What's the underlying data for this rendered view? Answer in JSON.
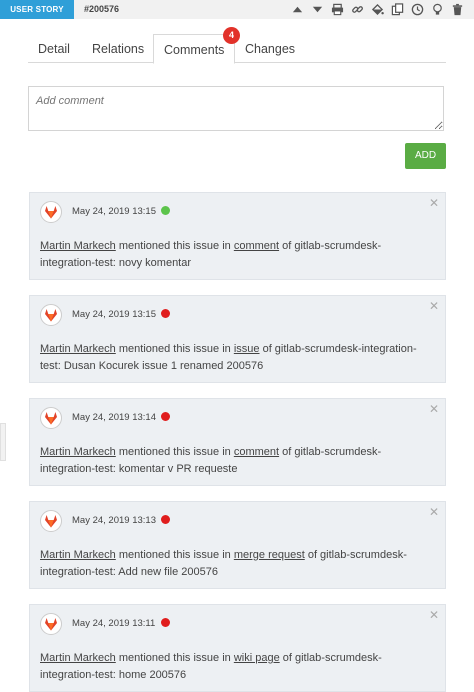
{
  "header": {
    "badge_label": "USER STORY",
    "story_id": "#200576",
    "icons": [
      "chevron-up-icon",
      "chevron-down-icon",
      "print-icon",
      "link-icon",
      "fill-icon",
      "copy-icon",
      "history-icon",
      "lightbulb-icon",
      "trash-icon"
    ]
  },
  "tabs": {
    "items": [
      {
        "label": "Detail"
      },
      {
        "label": "Relations"
      },
      {
        "label": "Comments"
      },
      {
        "label": "Changes"
      }
    ],
    "active": "Comments",
    "comments_count": "4"
  },
  "comment_form": {
    "placeholder": "Add comment",
    "add_label": "ADD"
  },
  "colors": {
    "accent": "#2f9fd8",
    "add_button": "#5aac44",
    "status_green": "#5cc44b",
    "status_red": "#e01d1d",
    "badge": "#e2322a"
  },
  "comments": [
    {
      "timestamp": "May 24, 2019 13:15",
      "status": "green",
      "author": "Martin Markech",
      "pre": "mentioned this issue in",
      "link": "comment",
      "post": "of gitlab-scrumdesk-integration-test: novy komentar"
    },
    {
      "timestamp": "May 24, 2019 13:15",
      "status": "red",
      "author": "Martin Markech",
      "pre": "mentioned this issue in",
      "link": "issue",
      "post": "of gitlab-scrumdesk-integration-test: Dusan Kocurek issue 1 renamed 200576"
    },
    {
      "timestamp": "May 24, 2019 13:14",
      "status": "red",
      "author": "Martin Markech",
      "pre": "mentioned this issue in",
      "link": "comment",
      "post": "of gitlab-scrumdesk-integration-test: komentar v PR requeste"
    },
    {
      "timestamp": "May 24, 2019 13:13",
      "status": "red",
      "author": "Martin Markech",
      "pre": "mentioned this issue in",
      "link": "merge request",
      "post": "of gitlab-scrumdesk-integration-test: Add new file 200576"
    },
    {
      "timestamp": "May 24, 2019 13:11",
      "status": "red",
      "author": "Martin Markech",
      "pre": "mentioned this issue in",
      "link": "wiki page",
      "post": "of gitlab-scrumdesk-integration-test: home 200576"
    }
  ]
}
